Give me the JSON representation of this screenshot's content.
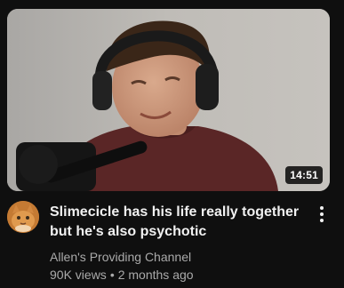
{
  "video": {
    "title": "Slimecicle has his life really together but he's also psychotic",
    "duration": "14:51",
    "channel": "Allen's Providing Channel",
    "views": "90K views",
    "separator": "•",
    "age": "2 months ago",
    "thumbnail_icon": "video-thumbnail",
    "avatar_icon": "cat-avatar-icon",
    "menu_icon": "more-vertical-icon"
  }
}
